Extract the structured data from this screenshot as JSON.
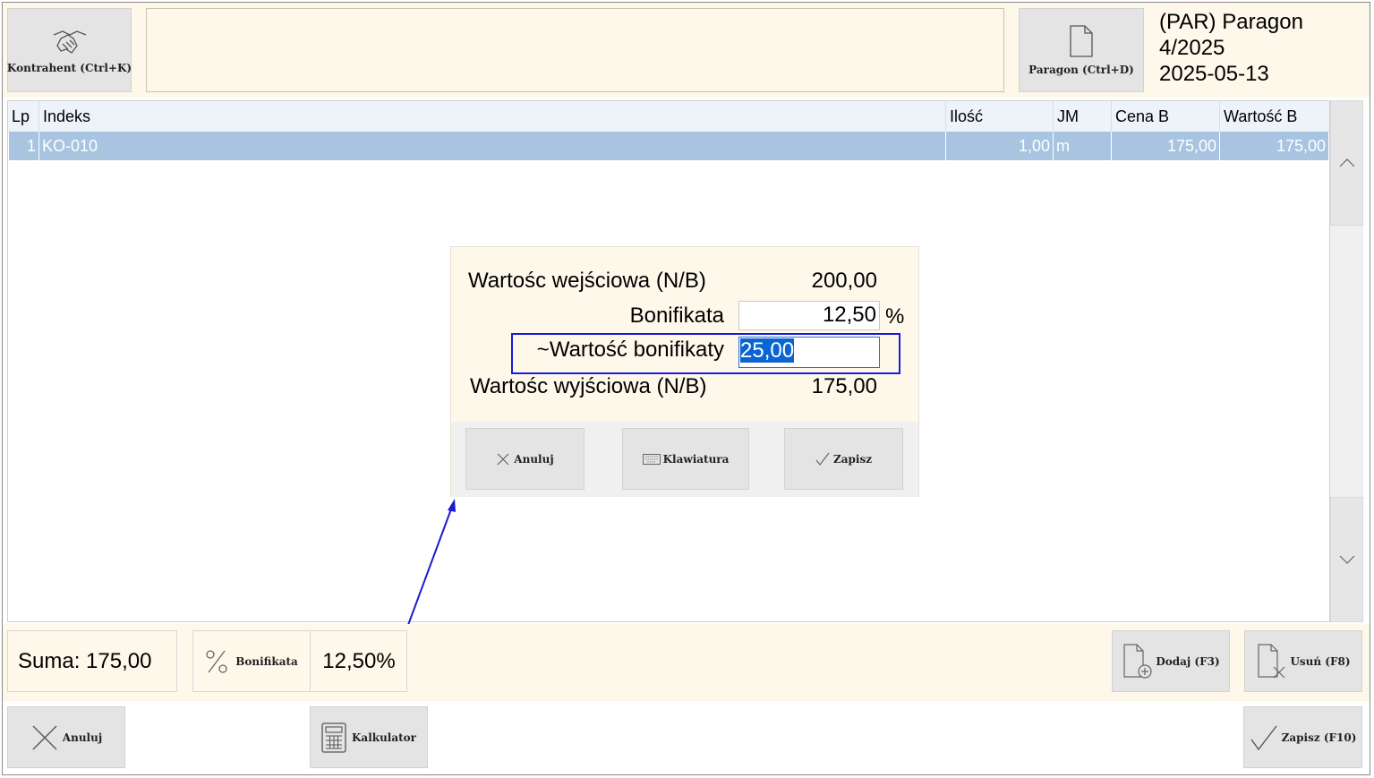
{
  "toolbar": {
    "contractor_label": "Kontrahent (Ctrl+K)",
    "document_label": "Paragon (Ctrl+D)"
  },
  "document": {
    "type": "(PAR) Paragon",
    "number": "4/2025",
    "date": "2025-05-13"
  },
  "table": {
    "headers": [
      "Lp",
      "Indeks",
      "Ilość",
      "JM",
      "Cena B",
      "Wartość B"
    ],
    "rows": [
      {
        "lp": "1",
        "indeks": "KO-010",
        "ilosc": "1,00",
        "jm": "m",
        "cena": "175,00",
        "wartosc": "175,00"
      }
    ]
  },
  "dialog": {
    "input_value_label": "Wartośc wejściowa (N/B)",
    "input_value": "200,00",
    "discount_label": "Bonifikata",
    "discount_percent": "12,50",
    "percent_sign": "%",
    "discount_value_label": "~Wartość bonifikaty",
    "discount_value": "25,00",
    "output_value_label": "Wartośc wyjściowa (N/B)",
    "output_value": "175,00",
    "cancel_label": "Anuluj",
    "keyboard_label": "Klawiatura",
    "save_label": "Zapisz"
  },
  "summary": {
    "total_label": "Suma: 175,00",
    "discount_button_label": "Bonifikata",
    "discount_value": "12,50%"
  },
  "actions": {
    "add_label": "Dodaj (F3)",
    "remove_label": "Usuń (F8)",
    "cancel_label": "Anuluj",
    "calculator_label": "Kalkulator",
    "save_label": "Zapisz (F10)"
  },
  "icons": {
    "contractor": "handshake-icon",
    "document": "document-icon",
    "scroll_up": "chevron-up-icon",
    "scroll_down": "chevron-down-icon",
    "cancel": "close-icon",
    "keyboard": "keyboard-icon",
    "save": "checkmark-icon",
    "percent": "percent-icon",
    "add": "document-add-icon",
    "remove": "document-remove-icon",
    "calculator": "calculator-icon"
  },
  "colors": {
    "panel_background": "#fdf8ea",
    "selected_row": "#a8c4e0",
    "highlight_outline": "#1b1bd6",
    "text_selection": "#0a64d2"
  }
}
